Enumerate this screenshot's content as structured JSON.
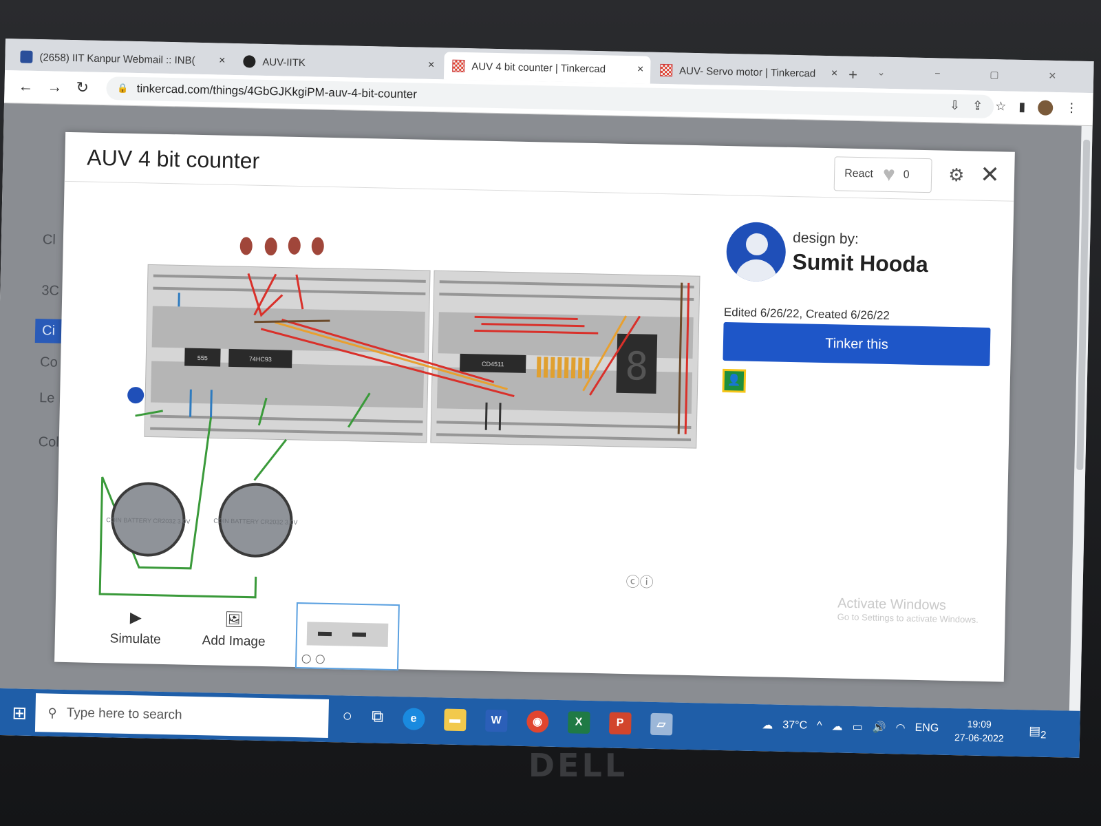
{
  "browser": {
    "tabs": [
      {
        "title": "(2658) IIT Kanpur Webmail :: INB(",
        "close": "×",
        "icon": "mail-icon"
      },
      {
        "title": "AUV-IITK",
        "close": "×",
        "icon": "github-icon"
      },
      {
        "title": "AUV 4 bit counter | Tinkercad",
        "close": "×",
        "icon": "tinkercad-icon"
      },
      {
        "title": "AUV- Servo motor | Tinkercad",
        "close": "×",
        "icon": "tinkercad-icon"
      }
    ],
    "new_tab": "+",
    "url": "tinkercad.com/things/4GbGJKkgiPM-auv-4-bit-counter"
  },
  "sidebar": {
    "items": [
      "Cl",
      "3C",
      "Ci",
      "Co",
      "Le",
      "Col"
    ]
  },
  "modal": {
    "title": "AUV 4 bit counter",
    "react_label": "React",
    "react_count": "0",
    "close": "✕",
    "designer_label": "design by:",
    "designer_name": "Sumit Hooda",
    "edited": "Edited 6/26/22, Created 6/26/22",
    "tinker_button": "Tinker this",
    "simulate_label": "Simulate",
    "add_image_label": "Add Image"
  },
  "circuit": {
    "chips": [
      "555",
      "74HC93",
      "CD4511"
    ],
    "battery_labels": [
      "COIN BATTERY CR2032 3.0V",
      "COIN BATTERY CR2032 3.0V"
    ]
  },
  "watermark": {
    "title": "Activate Windows",
    "subtitle": "Go to Settings to activate Windows."
  },
  "taskbar": {
    "search_placeholder": "Type here to search",
    "temperature": "37°C",
    "language": "ENG",
    "time": "19:09",
    "date": "27-06-2022",
    "notification_count": "2"
  },
  "device": {
    "brand": "DELL"
  },
  "colors": {
    "tinker_button": "#1e56c8",
    "taskbar": "#1f5ea8",
    "avatar": "#1f4fb8"
  }
}
